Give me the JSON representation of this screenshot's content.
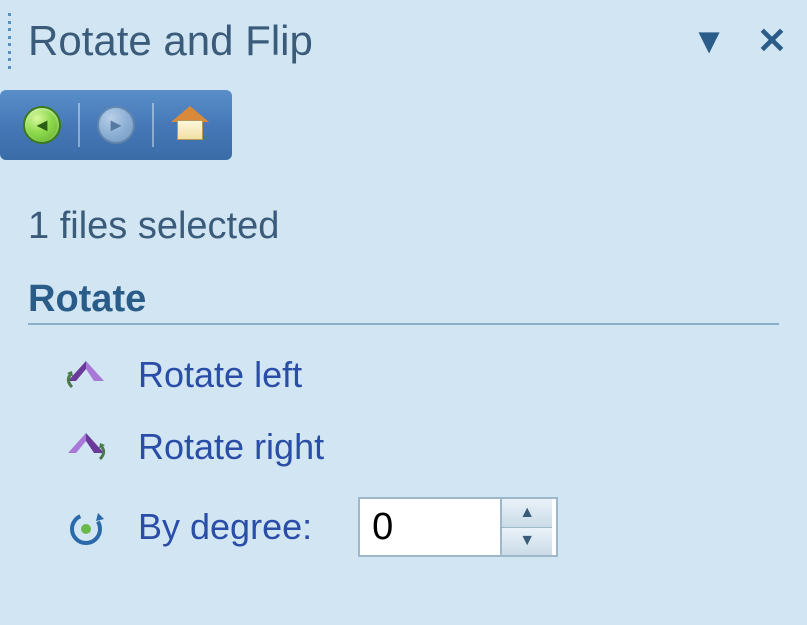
{
  "panel": {
    "title": "Rotate and Flip"
  },
  "status": {
    "text": "1 files selected"
  },
  "section": {
    "rotate_heading": "Rotate"
  },
  "actions": {
    "rotate_left": "Rotate left",
    "rotate_right": "Rotate right",
    "by_degree_label": "By degree:"
  },
  "degree": {
    "value": "0"
  }
}
